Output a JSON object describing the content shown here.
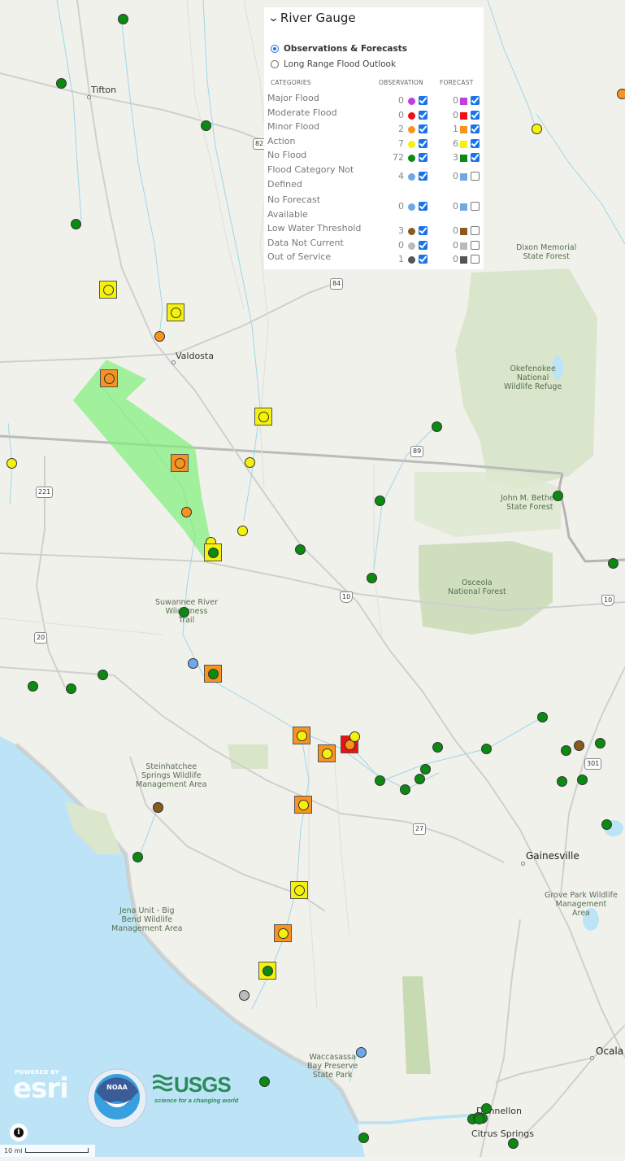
{
  "legend": {
    "title": "River Gauge",
    "modes": [
      {
        "label": "Observations & Forecasts",
        "selected": true
      },
      {
        "label": "Long Range Flood Outlook",
        "selected": false
      }
    ],
    "headers": {
      "categories": "CATEGORIES",
      "observation": "OBSERVATION",
      "forecast": "FORECAST"
    },
    "categories": [
      {
        "label": "Major Flood",
        "obs_count": "0",
        "obs_color": "#c13fe0",
        "obs_checked": true,
        "fc_count": "0",
        "fc_color": "#c13fe0",
        "fc_checked": true
      },
      {
        "label": "Moderate Flood",
        "obs_count": "0",
        "obs_color": "#ee1111",
        "obs_checked": true,
        "fc_count": "0",
        "fc_color": "#ee1111",
        "fc_checked": true
      },
      {
        "label": "Minor Flood",
        "obs_count": "2",
        "obs_color": "#f7931e",
        "obs_checked": true,
        "fc_count": "1",
        "fc_color": "#f7931e",
        "fc_checked": true
      },
      {
        "label": "Action",
        "obs_count": "7",
        "obs_color": "#f5f20a",
        "obs_checked": true,
        "fc_count": "6",
        "fc_color": "#f5f20a",
        "fc_checked": true
      },
      {
        "label": "No Flood",
        "obs_count": "72",
        "obs_color": "#0a8a10",
        "obs_checked": true,
        "fc_count": "3",
        "fc_color": "#0a8a10",
        "fc_checked": true
      },
      {
        "label": "Flood Category Not",
        "label2": "Defined",
        "obs_count": "4",
        "obs_color": "#6fa8e6",
        "obs_checked": true,
        "fc_count": "0",
        "fc_color": "#6fa8e6",
        "fc_checked": false
      },
      {
        "label": "No Forecast",
        "label2": "Available",
        "obs_count": "0",
        "obs_color": "#6fa8e6",
        "obs_checked": true,
        "fc_count": "0",
        "fc_color": "#6fa8e6",
        "fc_checked": false
      },
      {
        "label": "Low Water Threshold",
        "obs_count": "3",
        "obs_color": "#8a5a20",
        "obs_checked": true,
        "fc_count": "0",
        "fc_color": "#8a5a20",
        "fc_checked": false
      },
      {
        "label": "Data Not Current",
        "obs_count": "0",
        "obs_color": "#bbbbbb",
        "obs_checked": true,
        "fc_count": "0",
        "fc_color": "#bbbbbb",
        "fc_checked": false
      },
      {
        "label": "Out of Service",
        "obs_count": "1",
        "obs_color": "#555555",
        "obs_checked": true,
        "fc_count": "0",
        "fc_color": "#555555",
        "fc_checked": false
      }
    ]
  },
  "map": {
    "places": [
      {
        "name": "Tifton",
        "cls": "city"
      },
      {
        "name": "Valdosta",
        "cls": "city"
      },
      {
        "name": "Gainesville",
        "cls": "city-lg"
      },
      {
        "name": "Ocala",
        "cls": "city-lg"
      },
      {
        "name": "Dunnellon",
        "cls": "city"
      },
      {
        "name": "Citrus Springs",
        "cls": "city"
      }
    ],
    "parks": [
      "Dixon Memorial\nState Forest",
      "Okefenokee\nNational\nWildlife Refuge",
      "John M. Bethea\nState Forest",
      "Osceola\nNational Forest",
      "Suwannee River\nWilderness\nTrail",
      "Steinhatchee\nSprings Wildlife\nManagement Area",
      "Jena Unit - Big\nBend Wildlife\nManagement Area",
      "Grove Park Wildlife\nManagement\nArea",
      "Waccasassa\nBay Preserve\nState Park"
    ],
    "shields": [
      "82",
      "84",
      "221",
      "89",
      "20",
      "10",
      "10",
      "301",
      "27"
    ],
    "flood_area_color": "#7ef07a",
    "gauges": [
      {
        "obs": "No Flood"
      },
      {
        "obs": "No Flood"
      },
      {
        "obs": "No Flood"
      },
      {
        "obs": "No Flood"
      },
      {
        "obs": "Action"
      },
      {
        "obs": "Action"
      },
      {
        "obs": "Minor Flood"
      },
      {
        "obs": "Action",
        "fc": "Action"
      },
      {
        "obs": "Action",
        "fc": "Action"
      },
      {
        "obs": "Minor Flood"
      },
      {
        "obs": "Minor Flood",
        "fc": "Minor Flood"
      },
      {
        "obs": "Action",
        "fc": "Action"
      },
      {
        "obs": "Action"
      },
      {
        "obs": "Minor Flood",
        "fc": "Minor Flood"
      },
      {
        "obs": "Minor Flood"
      },
      {
        "obs": "Action"
      },
      {
        "obs": "Action"
      },
      {
        "obs": "No Flood",
        "fc": "Action"
      },
      {
        "obs": "No Flood"
      },
      {
        "obs": "No Flood"
      },
      {
        "obs": "No Flood"
      },
      {
        "obs": "No Flood"
      },
      {
        "obs": "No Flood"
      },
      {
        "obs": "No Flood"
      },
      {
        "obs": "No Flood"
      },
      {
        "obs": "Flood Category Not Defined"
      },
      {
        "obs": "No Flood",
        "fc": "Minor Flood"
      },
      {
        "obs": "No Flood"
      },
      {
        "obs": "No Flood"
      },
      {
        "obs": "No Flood"
      },
      {
        "obs": "Action",
        "fc": "Minor Flood"
      },
      {
        "obs": "Action",
        "fc": "Minor Flood"
      },
      {
        "obs": "Minor Flood",
        "fc": "Moderate Flood"
      },
      {
        "obs": "Action"
      },
      {
        "obs": "Action",
        "fc": "Minor Flood"
      },
      {
        "obs": "No Flood"
      },
      {
        "obs": "No Flood"
      },
      {
        "obs": "No Flood"
      },
      {
        "obs": "No Flood"
      },
      {
        "obs": "No Flood"
      },
      {
        "obs": "No Flood"
      },
      {
        "obs": "No Flood"
      },
      {
        "obs": "Low Water Threshold"
      },
      {
        "obs": "No Flood"
      },
      {
        "obs": "No Flood"
      },
      {
        "obs": "No Flood"
      },
      {
        "obs": "No Flood"
      },
      {
        "obs": "No Flood"
      },
      {
        "obs": "Low Water Threshold"
      },
      {
        "obs": "Low Water Threshold"
      },
      {
        "obs": "No Flood"
      },
      {
        "obs": "Action",
        "fc": "Action"
      },
      {
        "obs": "Action",
        "fc": "Minor Flood"
      },
      {
        "obs": "No Flood",
        "fc": "Action"
      },
      {
        "obs": "Data Not Current"
      },
      {
        "obs": "Flood Category Not Defined"
      },
      {
        "obs": "No Flood"
      },
      {
        "obs": "No Flood"
      },
      {
        "obs": "No Flood"
      },
      {
        "obs": "No Flood"
      },
      {
        "obs": "No Flood"
      },
      {
        "obs": "No Flood"
      },
      {
        "obs": "No Flood"
      },
      {
        "obs": "No Flood"
      }
    ]
  },
  "attribution": {
    "esri_powered": "POWERED BY",
    "esri_word": "esri",
    "noaa_word": "NOAA",
    "usgs_word": "USGS",
    "usgs_tagline": "science for a changing world",
    "info_glyph": "i",
    "scale_label": "10 mi"
  }
}
